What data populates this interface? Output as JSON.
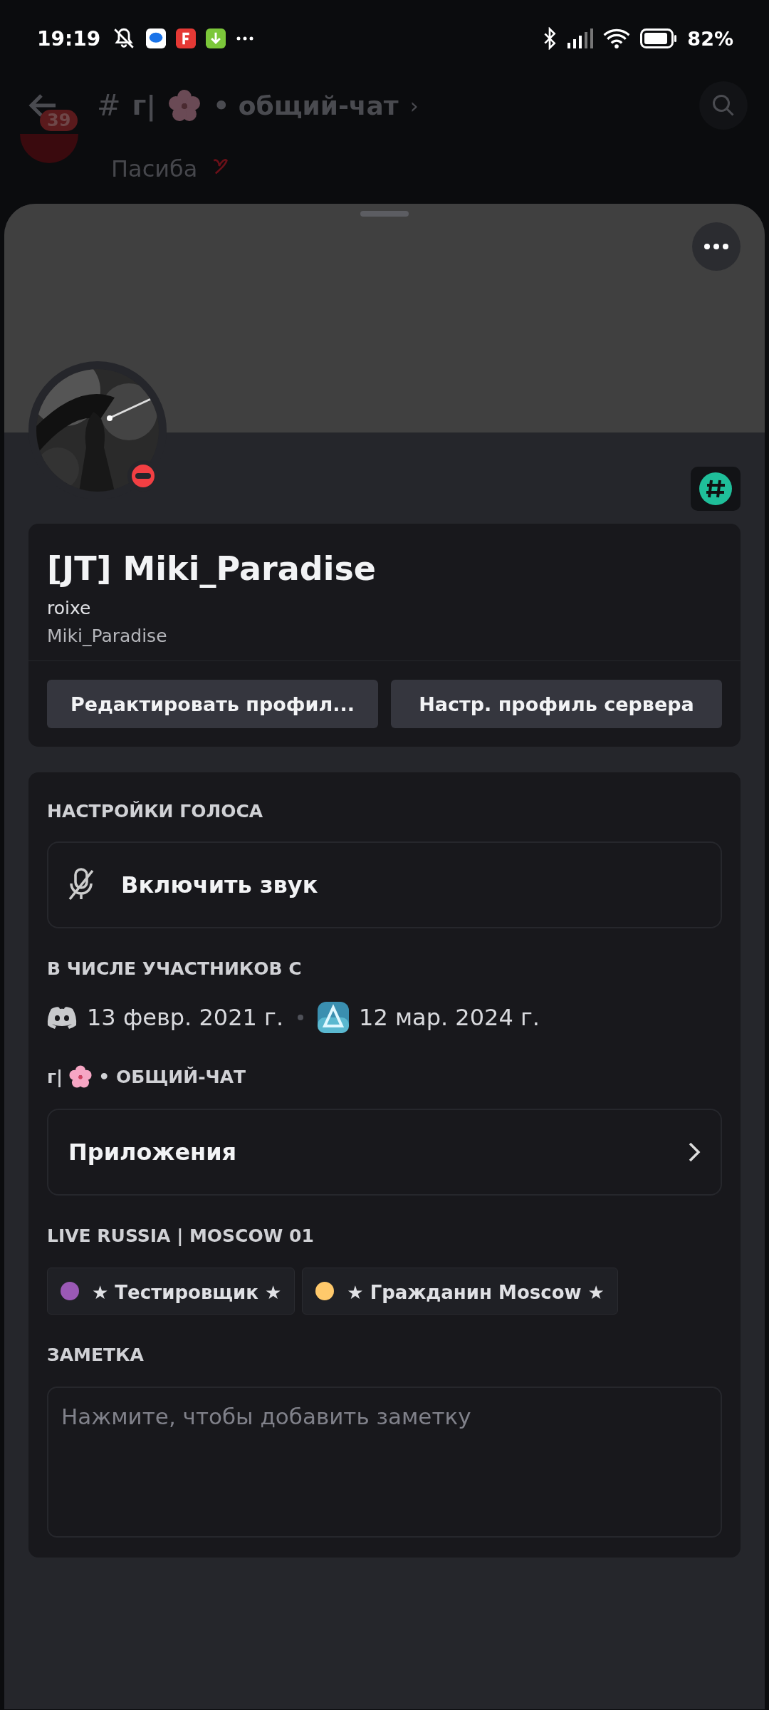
{
  "status_bar": {
    "time": "19:19",
    "battery": "82%"
  },
  "chat_header": {
    "back_badge": "39",
    "hash": "#",
    "channel_prefix": "г|",
    "channel_name": "• общий-чат",
    "chevron": "›"
  },
  "message": {
    "text": "Пасиба"
  },
  "profile": {
    "display_name": "[JT] Miki_Paradise",
    "username": "roixe",
    "server_nick": "Miki_Paradise",
    "do_not_disturb": true,
    "buttons": [
      {
        "label": "Редактировать профил..."
      },
      {
        "label": "Настр. профиль сервера"
      }
    ]
  },
  "voice": {
    "heading": "НАСТРОЙКИ ГОЛОСА",
    "action": "Включить звук"
  },
  "member_since": {
    "heading": "В ЧИСЛЕ УЧАСТНИКОВ С",
    "discord_date": "13 февр. 2021 г.",
    "server_date": "12 мар. 2024 г."
  },
  "channel": {
    "prefix": "г|",
    "name": "• ОБЩИЙ-ЧАТ",
    "row": "Приложения"
  },
  "server": {
    "heading": "LIVE RUSSIA | MOSCOW 01",
    "roles": [
      {
        "name": "★ Тестировщик ★",
        "color": "#9b59b6"
      },
      {
        "name": "★ Гражданин Moscow ★",
        "color": "#ffc96b"
      }
    ]
  },
  "note": {
    "heading": "ЗАМЕТКА",
    "placeholder": "Нажмите, чтобы добавить заметку"
  }
}
